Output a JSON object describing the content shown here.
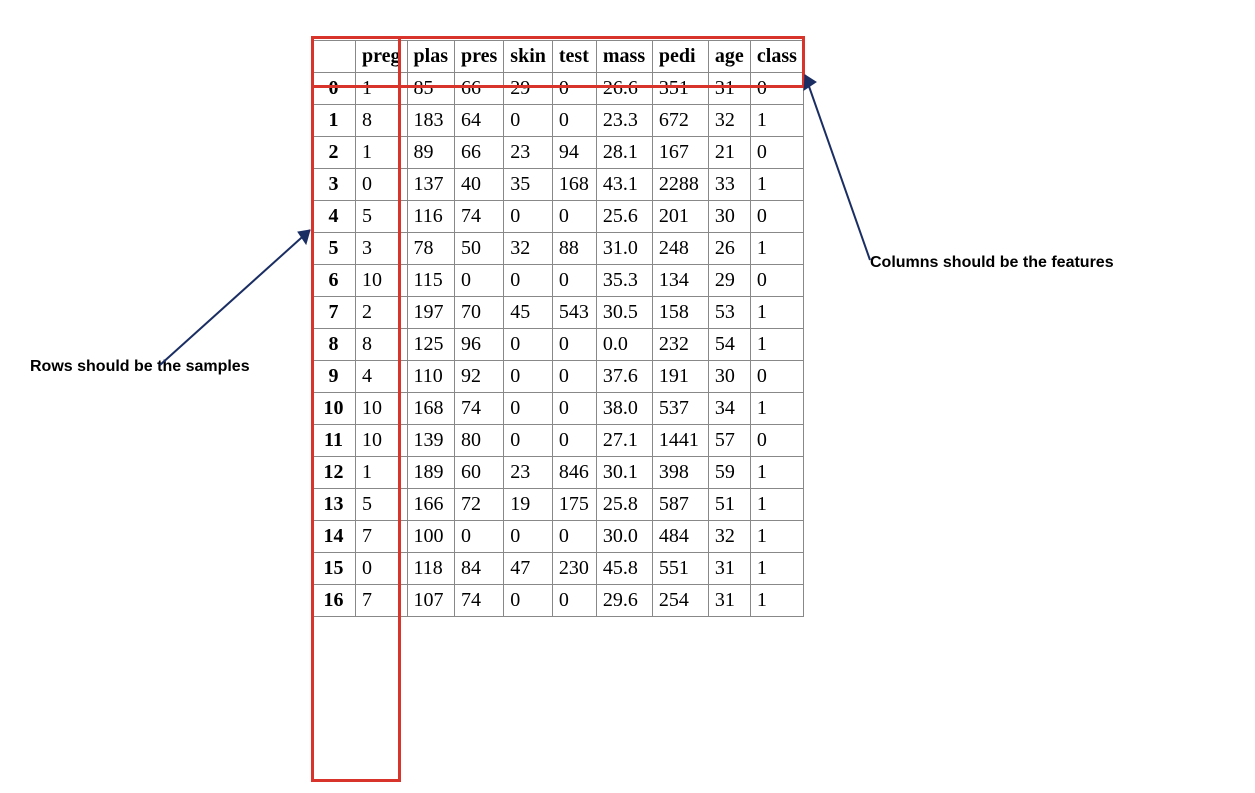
{
  "annotations": {
    "rows_label": "Rows should be the samples",
    "cols_label": "Columns should be the features"
  },
  "table": {
    "columns": [
      "preg",
      "plas",
      "pres",
      "skin",
      "test",
      "mass",
      "pedi",
      "age",
      "class"
    ],
    "rows": [
      {
        "idx": "0",
        "preg": "1",
        "plas": "85",
        "pres": "66",
        "skin": "29",
        "test": "0",
        "mass": "26.6",
        "pedi": "351",
        "age": "31",
        "class": "0"
      },
      {
        "idx": "1",
        "preg": "8",
        "plas": "183",
        "pres": "64",
        "skin": "0",
        "test": "0",
        "mass": "23.3",
        "pedi": "672",
        "age": "32",
        "class": "1"
      },
      {
        "idx": "2",
        "preg": "1",
        "plas": "89",
        "pres": "66",
        "skin": "23",
        "test": "94",
        "mass": "28.1",
        "pedi": "167",
        "age": "21",
        "class": "0"
      },
      {
        "idx": "3",
        "preg": "0",
        "plas": "137",
        "pres": "40",
        "skin": "35",
        "test": "168",
        "mass": "43.1",
        "pedi": "2288",
        "age": "33",
        "class": "1"
      },
      {
        "idx": "4",
        "preg": "5",
        "plas": "116",
        "pres": "74",
        "skin": "0",
        "test": "0",
        "mass": "25.6",
        "pedi": "201",
        "age": "30",
        "class": "0"
      },
      {
        "idx": "5",
        "preg": "3",
        "plas": "78",
        "pres": "50",
        "skin": "32",
        "test": "88",
        "mass": "31.0",
        "pedi": "248",
        "age": "26",
        "class": "1"
      },
      {
        "idx": "6",
        "preg": "10",
        "plas": "115",
        "pres": "0",
        "skin": "0",
        "test": "0",
        "mass": "35.3",
        "pedi": "134",
        "age": "29",
        "class": "0"
      },
      {
        "idx": "7",
        "preg": "2",
        "plas": "197",
        "pres": "70",
        "skin": "45",
        "test": "543",
        "mass": "30.5",
        "pedi": "158",
        "age": "53",
        "class": "1"
      },
      {
        "idx": "8",
        "preg": "8",
        "plas": "125",
        "pres": "96",
        "skin": "0",
        "test": "0",
        "mass": "0.0",
        "pedi": "232",
        "age": "54",
        "class": "1"
      },
      {
        "idx": "9",
        "preg": "4",
        "plas": "110",
        "pres": "92",
        "skin": "0",
        "test": "0",
        "mass": "37.6",
        "pedi": "191",
        "age": "30",
        "class": "0"
      },
      {
        "idx": "10",
        "preg": "10",
        "plas": "168",
        "pres": "74",
        "skin": "0",
        "test": "0",
        "mass": "38.0",
        "pedi": "537",
        "age": "34",
        "class": "1"
      },
      {
        "idx": "11",
        "preg": "10",
        "plas": "139",
        "pres": "80",
        "skin": "0",
        "test": "0",
        "mass": "27.1",
        "pedi": "1441",
        "age": "57",
        "class": "0"
      },
      {
        "idx": "12",
        "preg": "1",
        "plas": "189",
        "pres": "60",
        "skin": "23",
        "test": "846",
        "mass": "30.1",
        "pedi": "398",
        "age": "59",
        "class": "1"
      },
      {
        "idx": "13",
        "preg": "5",
        "plas": "166",
        "pres": "72",
        "skin": "19",
        "test": "175",
        "mass": "25.8",
        "pedi": "587",
        "age": "51",
        "class": "1"
      },
      {
        "idx": "14",
        "preg": "7",
        "plas": "100",
        "pres": "0",
        "skin": "0",
        "test": "0",
        "mass": "30.0",
        "pedi": "484",
        "age": "32",
        "class": "1"
      },
      {
        "idx": "15",
        "preg": "0",
        "plas": "118",
        "pres": "84",
        "skin": "47",
        "test": "230",
        "mass": "45.8",
        "pedi": "551",
        "age": "31",
        "class": "1"
      },
      {
        "idx": "16",
        "preg": "7",
        "plas": "107",
        "pres": "74",
        "skin": "0",
        "test": "0",
        "mass": "29.6",
        "pedi": "254",
        "age": "31",
        "class": "1"
      }
    ]
  }
}
